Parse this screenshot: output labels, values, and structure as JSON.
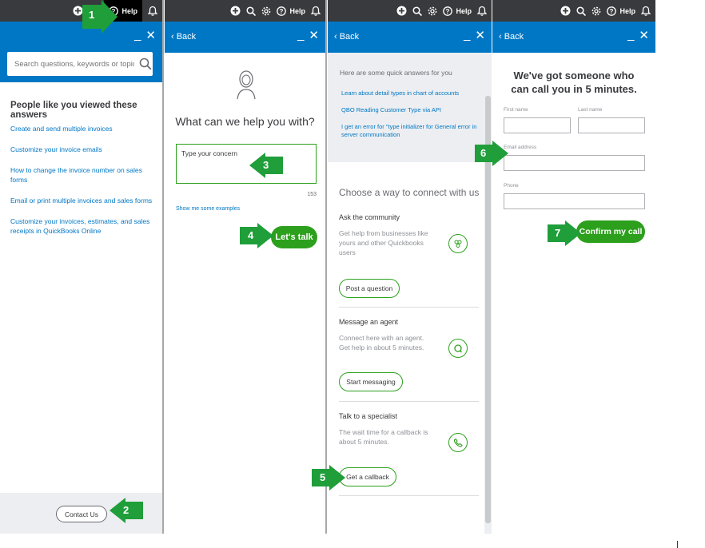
{
  "topbar": {
    "help_label": "Help"
  },
  "panel1": {
    "search_placeholder": "Search questions, keywords or topics",
    "section_title": "People like you viewed these answers",
    "links": [
      "Create and send multiple invoices",
      "Customize your invoice emails",
      "How to change the invoice number on sales forms",
      "Email or print multiple invoices and sales forms",
      "Customize your invoices, estimates, and sales receipts in QuickBooks Online"
    ],
    "contact_button": "Contact Us"
  },
  "panel2": {
    "back": "‹ Back",
    "heading": "What can we help you with?",
    "textarea_value": "Type your concern",
    "char_count": "153",
    "examples_link": "Show me some examples",
    "lets_talk_button": "Let's talk"
  },
  "panel3": {
    "back": "‹ Back",
    "quick_title": "Here are some quick answers for you",
    "quick_links": [
      "Learn about detail types in chart of accounts",
      "QBO Reading Customer Type via API",
      "I get an error for \"type initializer for General error in server communication"
    ],
    "choose_title": "Choose a way to connect with us",
    "options": [
      {
        "title": "Ask the community",
        "desc": "Get help from businesses like yours and other Quickbooks users",
        "button": "Post a question"
      },
      {
        "title": "Message an agent",
        "desc": "Connect here with an agent. Get help in about 5 minutes.",
        "button": "Start messaging"
      },
      {
        "title": "Talk to a specialist",
        "desc": "The wait time for a callback is about 5 minutes.",
        "button": "Get a callback"
      }
    ]
  },
  "panel4": {
    "back": "‹ Back",
    "heading": "We've got someone who can call you in 5 minutes.",
    "first_name_label": "First name",
    "last_name_label": "Last name",
    "email_label": "Email address",
    "phone_label": "Phone",
    "confirm_button": "Confirm my call"
  },
  "steps": [
    "1",
    "2",
    "3",
    "4",
    "5",
    "6",
    "7"
  ],
  "colors": {
    "topbar": "#393a3d",
    "header": "#0077c5",
    "accent_green": "#2ca01c",
    "link": "#0077c5",
    "arrow": "#1f9e3a"
  }
}
